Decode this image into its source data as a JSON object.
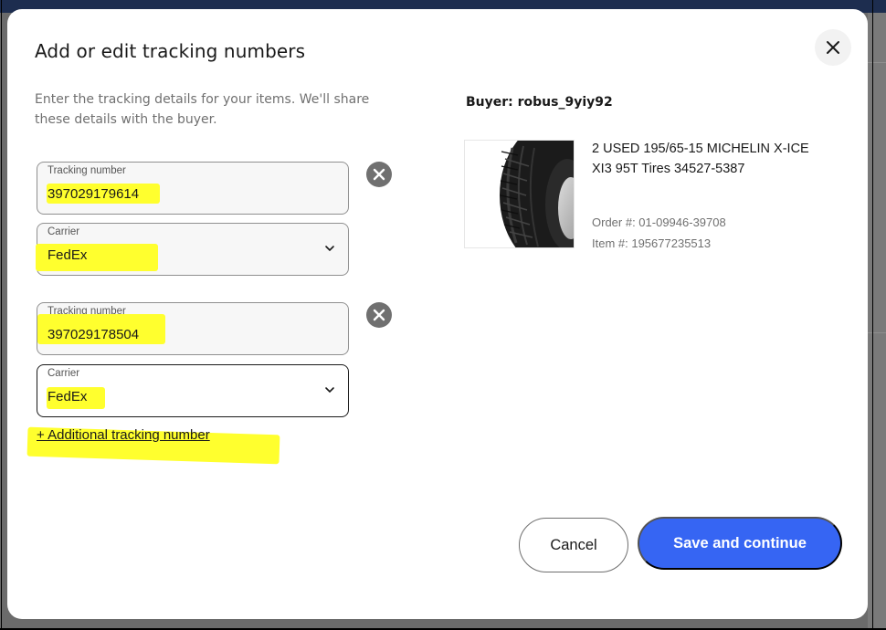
{
  "dialog": {
    "title": "Add or edit tracking numbers",
    "description": "Enter the tracking details for your items. We'll share these details with the buyer."
  },
  "trackings": [
    {
      "tracking_label": "Tracking number",
      "tracking_value": "397029179614",
      "carrier_label": "Carrier",
      "carrier_value": "FedEx"
    },
    {
      "tracking_label": "Tracking number",
      "tracking_value": "397029178504",
      "carrier_label": "Carrier",
      "carrier_value": "FedEx"
    }
  ],
  "add_link": "+ Additional tracking number",
  "buyer": "Buyer: robus_9yiy92",
  "item": {
    "title": "2 USED 195/65-15 MICHELIN X-ICE XI3 95T Tires 34527-5387",
    "order": "Order #: 01-09946-39708",
    "item_no": "Item #: 195677235513"
  },
  "buttons": {
    "cancel": "Cancel",
    "save": "Save and continue"
  },
  "colors": {
    "primary": "#3665f3",
    "highlight": "#ffff2e",
    "backdrop": "#6b6b6b"
  },
  "icons": {
    "close": "close-icon",
    "remove": "remove-circle-icon",
    "chevron": "chevron-down-icon"
  }
}
